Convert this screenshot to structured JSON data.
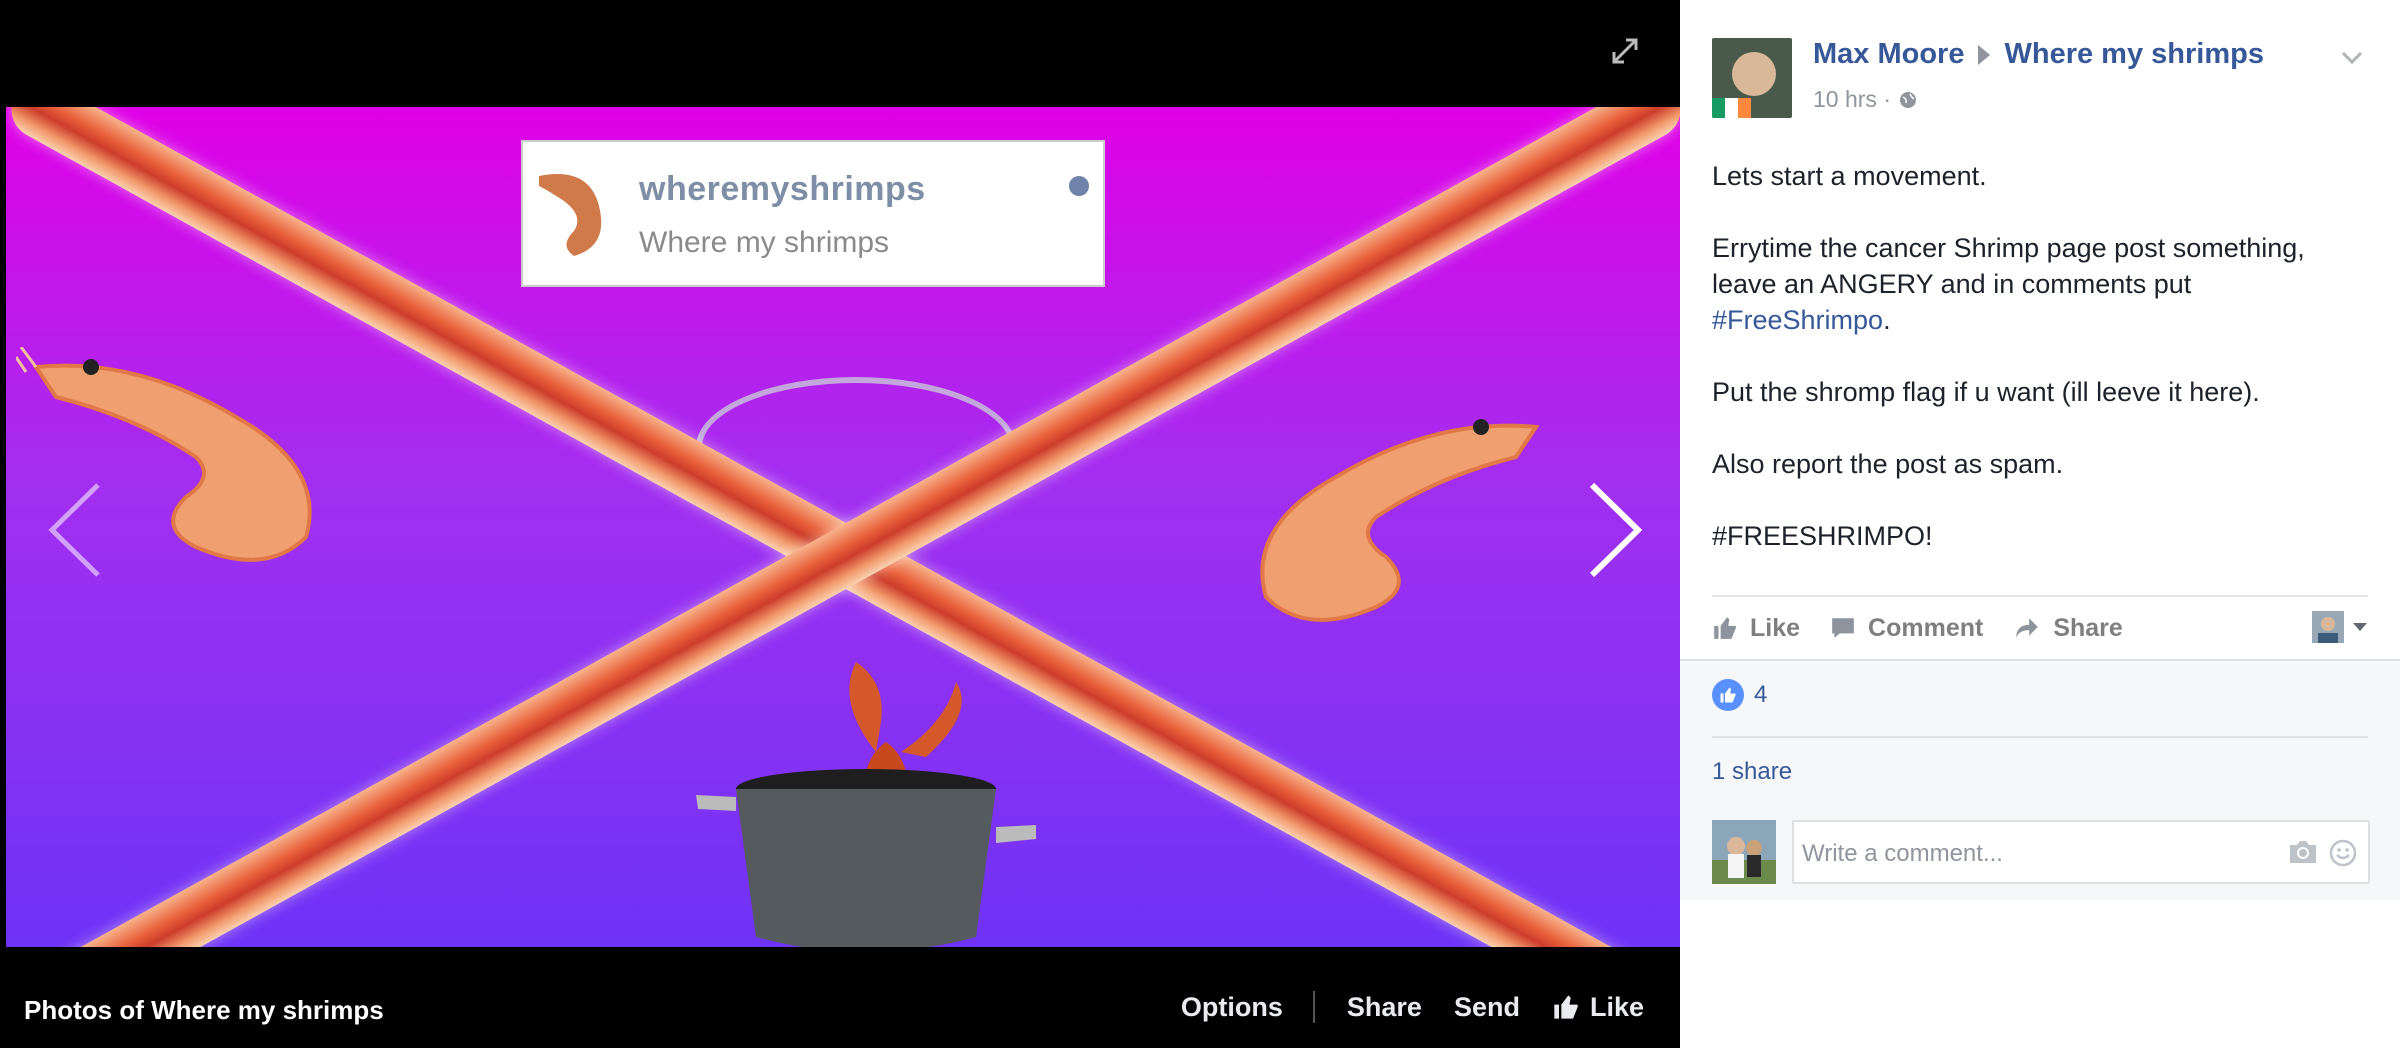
{
  "viewer": {
    "card": {
      "handle": "wheremyshrimps",
      "page_name": "Where my shrimps"
    },
    "footer": {
      "album_title": "Photos of Where my shrimps",
      "options_label": "Options",
      "share_label": "Share",
      "send_label": "Send",
      "like_label": "Like"
    }
  },
  "post": {
    "author": "Max Moore",
    "target_page": "Where my shrimps",
    "time": "10 hrs ·",
    "paragraphs": {
      "p1": "Lets start a movement.",
      "p2_text": "Errytime the cancer Shrimp page post something, leave an ANGERY and in comments put ",
      "p2_tag": "#FreeShrimpo",
      "p2_end": ".",
      "p3": "Put the shromp flag if u want (ill leeve it here).",
      "p4": "Also report the post as spam.",
      "p5": "#FREESHRIMPO!"
    },
    "actions": {
      "like": "Like",
      "comment": "Comment",
      "share": "Share"
    },
    "likes_count": "4",
    "shares_text": "1 share",
    "comment_placeholder": "Write a comment..."
  },
  "colors": {
    "link": "#365899",
    "gradient_top": "#e000e6",
    "gradient_bottom": "#6e33f6",
    "like_blue": "#5890ff"
  }
}
